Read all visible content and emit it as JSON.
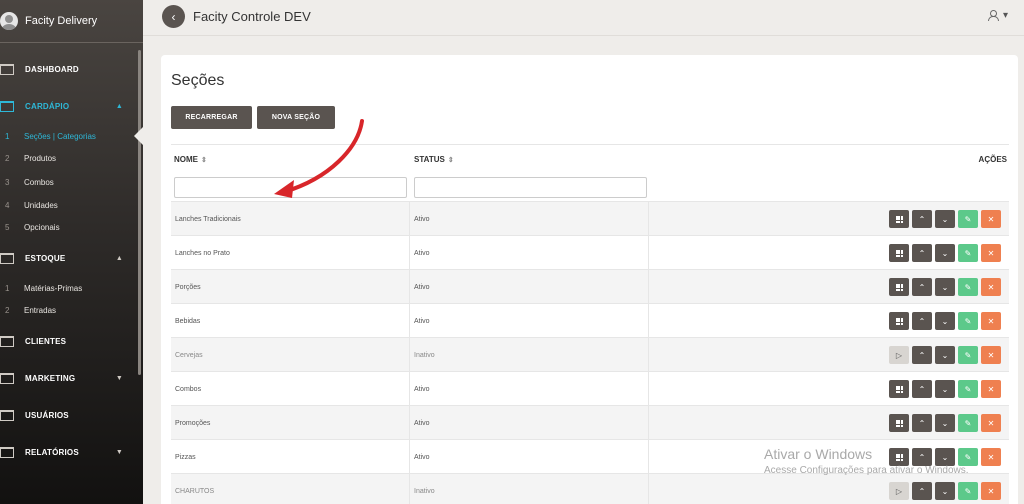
{
  "sidebar": {
    "brand": "Facity Delivery",
    "menu": [
      {
        "label": "DASHBOARD"
      },
      {
        "label": "CARDÁPIO"
      },
      {
        "label": "ESTOQUE"
      },
      {
        "label": "CLIENTES"
      },
      {
        "label": "MARKETING"
      },
      {
        "label": "USUÁRIOS"
      },
      {
        "label": "RELATÓRIOS"
      }
    ],
    "cardapio_sub": [
      {
        "num": "1",
        "label": "Seções | Categorias"
      },
      {
        "num": "2",
        "label": "Produtos"
      },
      {
        "num": "3",
        "label": "Combos"
      },
      {
        "num": "4",
        "label": "Unidades"
      },
      {
        "num": "5",
        "label": "Opcionais"
      }
    ],
    "estoque_sub": [
      {
        "num": "1",
        "label": "Matérias-Primas"
      },
      {
        "num": "2",
        "label": "Entradas"
      }
    ]
  },
  "header": {
    "back_icon": "‹",
    "title": "Facity Controle DEV",
    "user_caret": "▾"
  },
  "page": {
    "title": "Seções",
    "reload_label": "RECARREGAR",
    "new_label": "NOVA SEÇÃO"
  },
  "table": {
    "columns": {
      "name": "NOME",
      "status": "STATUS",
      "actions": "AÇÕES",
      "sort_icon": "⇕"
    },
    "filters": {
      "name": "",
      "status": ""
    },
    "rows": [
      {
        "name": "Lanches Tradicionais",
        "status": "Ativo",
        "active": true
      },
      {
        "name": "Lanches no Prato",
        "status": "Ativo",
        "active": true
      },
      {
        "name": "Porções",
        "status": "Ativo",
        "active": true
      },
      {
        "name": "Bebidas",
        "status": "Ativo",
        "active": true
      },
      {
        "name": "Cervejas",
        "status": "Inativo",
        "active": false
      },
      {
        "name": "Combos",
        "status": "Ativo",
        "active": true
      },
      {
        "name": "Promoções",
        "status": "Ativo",
        "active": true
      },
      {
        "name": "Pizzas",
        "status": "Ativo",
        "active": true
      },
      {
        "name": "CHARUTOS",
        "status": "Inativo",
        "active": false
      }
    ],
    "action_icons": {
      "play": "▷",
      "up": "⌃",
      "down": "⌄",
      "edit": "✎",
      "delete": "✕"
    }
  },
  "watermark": {
    "line1": "Ativar o Windows",
    "line2": "Acesse Configurações para ativar o Windows."
  },
  "colors": {
    "accent": "#2eb8d8",
    "dark_button": "#5a5450",
    "green": "#5cc98a",
    "red": "#ef8050",
    "annotation_arrow": "#d8262a"
  }
}
